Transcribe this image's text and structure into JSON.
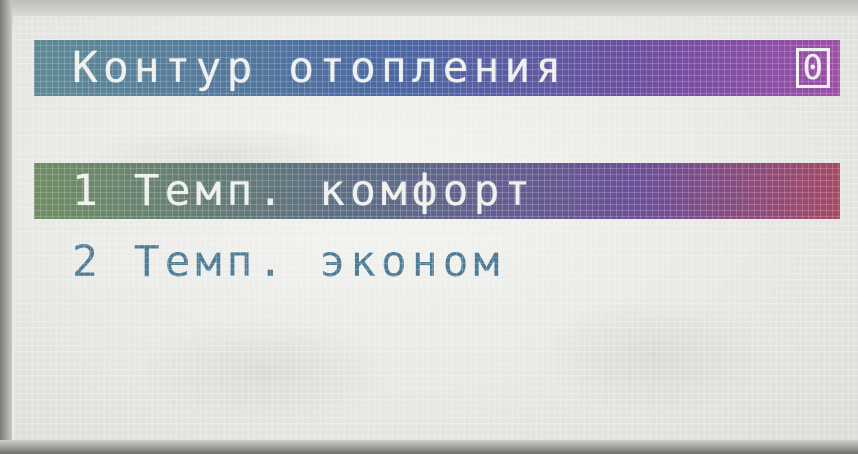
{
  "display": {
    "header": {
      "title": "Контур отопления",
      "number": "0"
    },
    "menu": {
      "items": [
        {
          "label": "1 Темп. комфорт",
          "selected": true
        },
        {
          "label": "2 Темп. эконом",
          "selected": false
        }
      ]
    },
    "colors": {
      "header_bar": "#4b68a2",
      "selected_bar": "#6c4f9a",
      "item_text": "#4f7c96",
      "screen_background": "#e9eae6"
    }
  }
}
